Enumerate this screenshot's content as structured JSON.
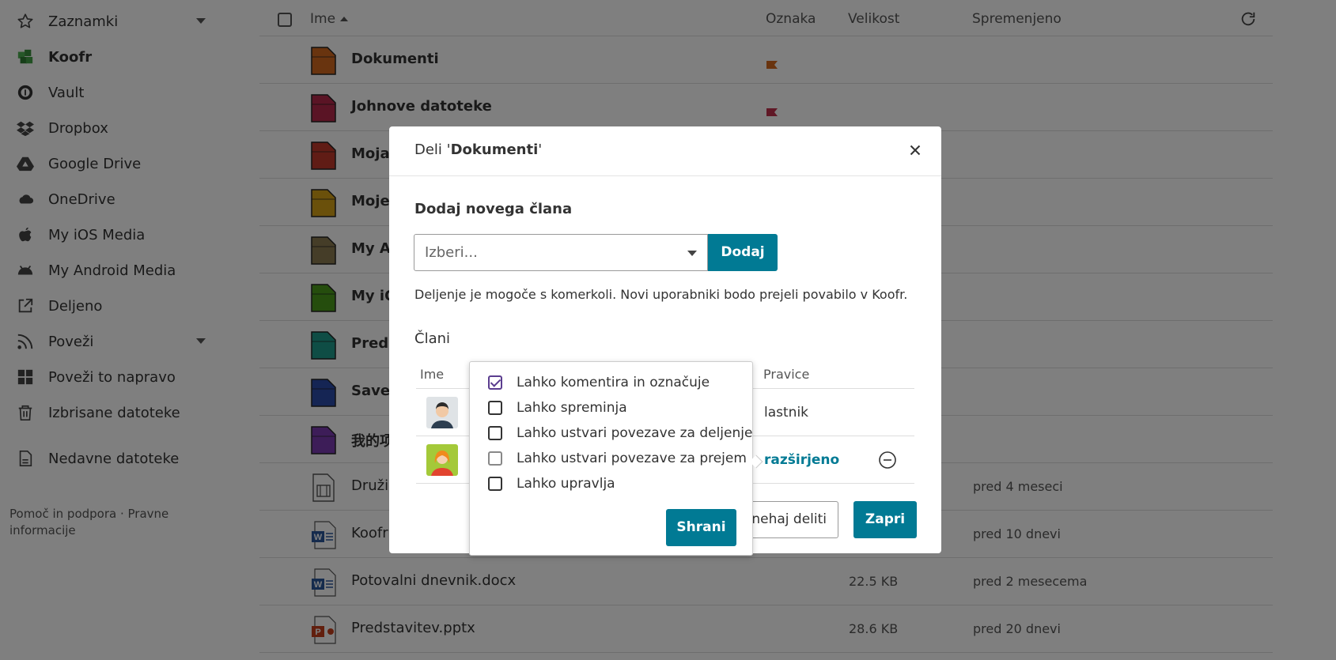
{
  "sidebar": {
    "items": [
      {
        "label": "Zaznamki",
        "icon": "star-icon",
        "expandable": true
      },
      {
        "label": "Koofr",
        "icon": "koofr-icon",
        "active": true
      },
      {
        "label": "Vault",
        "icon": "vault-icon"
      },
      {
        "label": "Dropbox",
        "icon": "dropbox-icon"
      },
      {
        "label": "Google Drive",
        "icon": "google-drive-icon"
      },
      {
        "label": "OneDrive",
        "icon": "onedrive-icon"
      },
      {
        "label": "My iOS Media",
        "icon": "apple-icon"
      },
      {
        "label": "My Android Media",
        "icon": "android-icon"
      },
      {
        "label": "Deljeno",
        "icon": "share-icon"
      },
      {
        "label": "Poveži",
        "icon": "rss-icon",
        "expandable": true
      },
      {
        "label": "Poveži to napravo",
        "icon": "windows-icon"
      },
      {
        "label": "Izbrisane datoteke",
        "icon": "trash-icon"
      },
      {
        "label": "Nedavne datoteke",
        "icon": "recent-files-icon"
      }
    ],
    "footer": "Pomoč in podpora · Pravne informacije"
  },
  "filelist": {
    "headers": {
      "name": "Ime",
      "tag": "Oznaka",
      "size": "Velikost",
      "modified": "Spremenjeno"
    },
    "rows": [
      {
        "name": "Dokumenti",
        "type": "folder",
        "color": "#d2691e",
        "flag": "#d2691e"
      },
      {
        "name": "Johnove datoteke",
        "type": "folder",
        "color": "#b5294a",
        "flag": "#c0304c"
      },
      {
        "name": "Moja",
        "type": "folder",
        "color": "#c0392b"
      },
      {
        "name": "Moje",
        "type": "folder",
        "color": "#d4a017"
      },
      {
        "name": "My Ar",
        "type": "folder",
        "color": "#8a7a50"
      },
      {
        "name": "My iO",
        "type": "folder",
        "color": "#4a9a1a"
      },
      {
        "name": "Preds",
        "type": "folder",
        "color": "#1f9a8a"
      },
      {
        "name": "Save t",
        "type": "folder",
        "color": "#2a4aa8"
      },
      {
        "name": "我的项",
        "type": "folder",
        "color": "#7a3ab0"
      },
      {
        "name": "Družin",
        "type": "video",
        "modified": "pred 4 meseci"
      },
      {
        "name": "Koofr",
        "type": "word",
        "modified": "pred 10 dnevi"
      },
      {
        "name": "Potovalni dnevnik.docx",
        "type": "word",
        "size": "22.5 KB",
        "modified": "pred 2 mesecema"
      },
      {
        "name": "Predstavitev.pptx",
        "type": "powerpoint",
        "size": "28.6 KB",
        "modified": "pred 20 dnevi"
      }
    ]
  },
  "modal": {
    "title_prefix": "Deli '",
    "title_name": "Dokumenti",
    "title_suffix": "'",
    "add_member_heading": "Dodaj novega člana",
    "select_placeholder": "Izberi...",
    "add_button": "Dodaj",
    "hint": "Deljenje je mogoče s komerkoli. Novi uporabniki bodo prejeli povabilo v Koofr.",
    "members_heading": "Člani",
    "table_headers": {
      "name": "Ime",
      "rights": "Pravice"
    },
    "members": [
      {
        "rights": "lastnik"
      },
      {
        "rights": "razširjeno"
      }
    ],
    "stop_sharing_button": "nehaj deliti",
    "close_button": "Zapri"
  },
  "popover": {
    "options": [
      {
        "label": "Lahko komentira in označuje",
        "checked": true
      },
      {
        "label": "Lahko spreminja",
        "checked": false
      },
      {
        "label": "Lahko ustvari povezave za deljenje",
        "checked": false
      },
      {
        "label": "Lahko ustvari povezave za prejem",
        "checked": false
      },
      {
        "label": "Lahko upravlja",
        "checked": false
      }
    ],
    "save_button": "Shrani"
  },
  "colors": {
    "accent": "#017a94",
    "checkbox": "#5b3d8f"
  }
}
